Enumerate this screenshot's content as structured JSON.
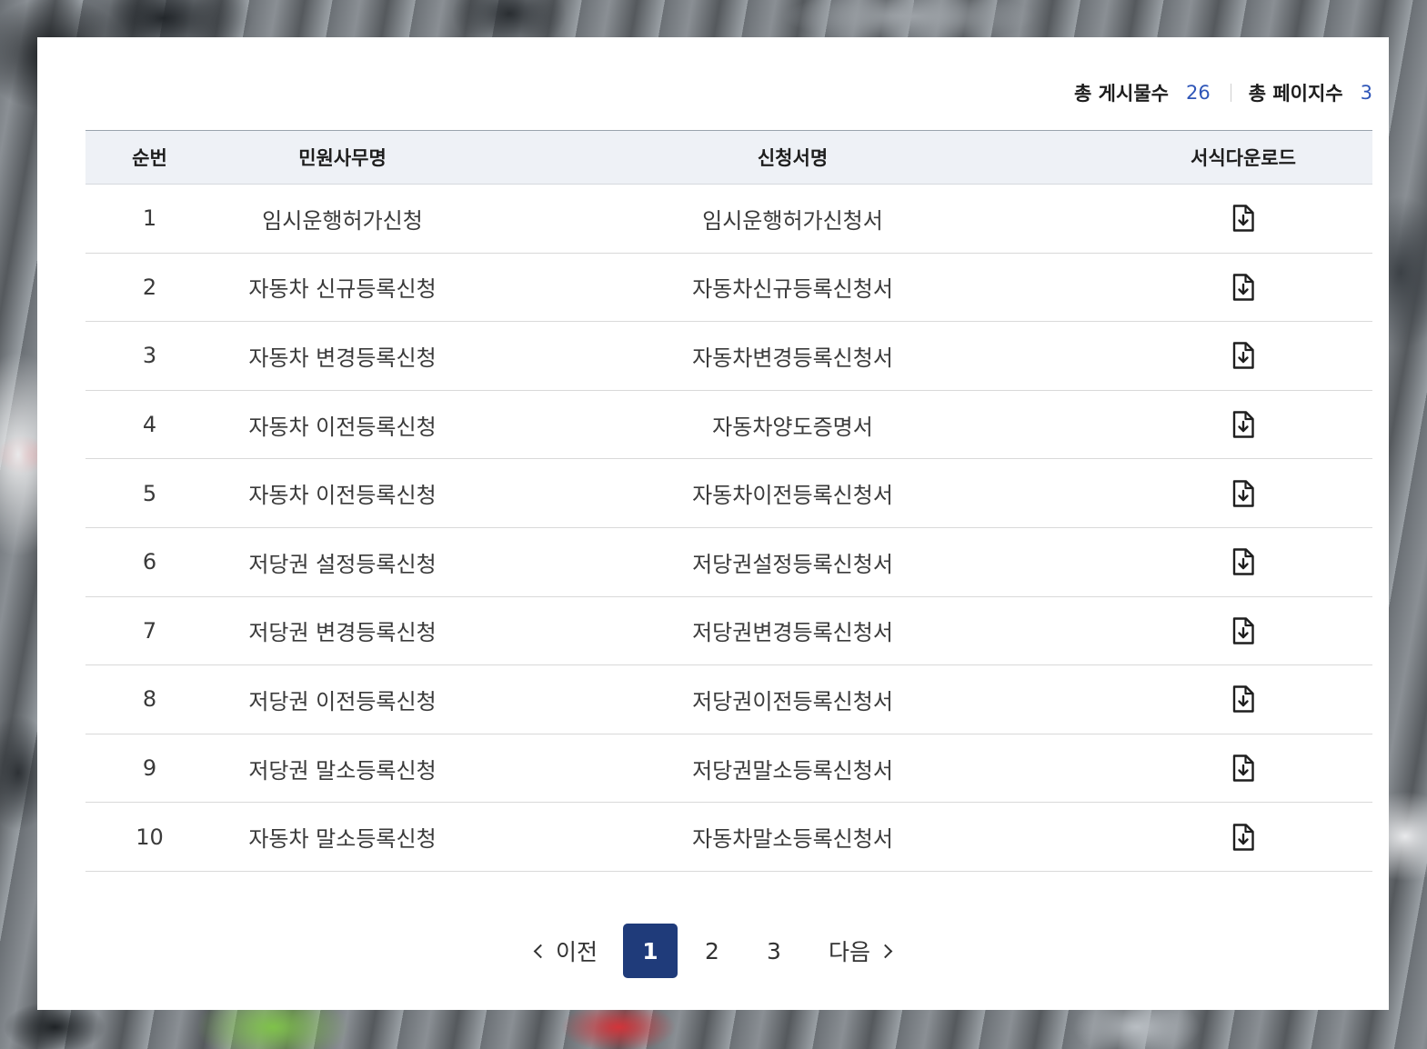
{
  "summary": {
    "total_posts_label": "총 게시물수",
    "total_posts_value": "26",
    "total_pages_label": "총 페이지수",
    "total_pages_value": "3"
  },
  "table": {
    "headers": [
      "순번",
      "민원사무명",
      "신청서명",
      "서식다운로드"
    ],
    "rows": [
      {
        "no": "1",
        "office": "임시운행허가신청",
        "form": "임시운행허가신청서"
      },
      {
        "no": "2",
        "office": "자동차 신규등록신청",
        "form": "자동차신규등록신청서"
      },
      {
        "no": "3",
        "office": "자동차 변경등록신청",
        "form": "자동차변경등록신청서"
      },
      {
        "no": "4",
        "office": "자동차 이전등록신청",
        "form": "자동차양도증명서"
      },
      {
        "no": "5",
        "office": "자동차 이전등록신청",
        "form": "자동차이전등록신청서"
      },
      {
        "no": "6",
        "office": "저당권 설정등록신청",
        "form": "저당권설정등록신청서"
      },
      {
        "no": "7",
        "office": "저당권 변경등록신청",
        "form": "저당권변경등록신청서"
      },
      {
        "no": "8",
        "office": "저당권 이전등록신청",
        "form": "저당권이전등록신청서"
      },
      {
        "no": "9",
        "office": "저당권 말소등록신청",
        "form": "저당권말소등록신청서"
      },
      {
        "no": "10",
        "office": "자동차 말소등록신청",
        "form": "자동차말소등록신청서"
      }
    ],
    "download_icon": "file-download-icon"
  },
  "pagination": {
    "prev_label": "이전",
    "next_label": "다음",
    "pages": [
      "1",
      "2",
      "3"
    ],
    "current": "1"
  },
  "colors": {
    "accent": "#1f3b7a",
    "count_text": "#2f56b8",
    "header_bg": "#eef1f6"
  }
}
